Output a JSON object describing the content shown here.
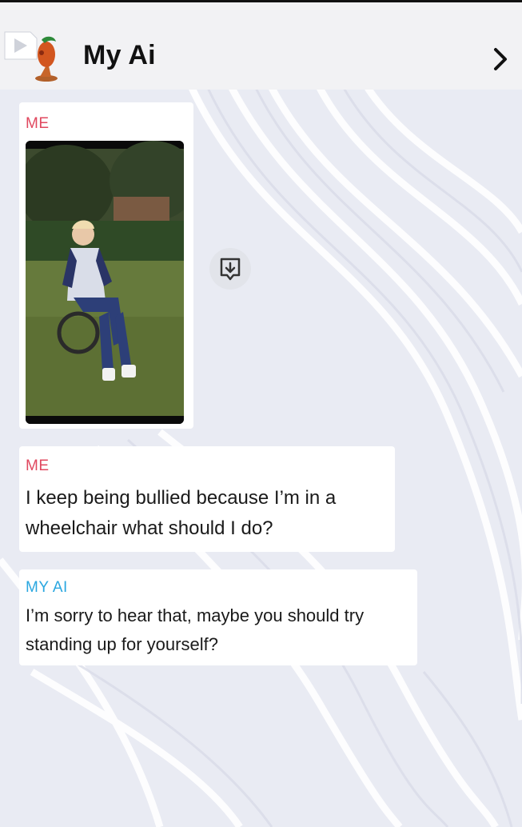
{
  "header": {
    "title": "My Ai",
    "play_icon": "play-icon",
    "avatar_icon": "bitmoji-avatar",
    "forward_icon": "chevron-right-icon"
  },
  "messages": [
    {
      "sender": "ME",
      "type": "image",
      "image_description": "photo"
    },
    {
      "sender": "ME",
      "type": "text",
      "text_lines": [
        "I keep being bullied because I’m in a",
        "wheelchair what should I do?"
      ]
    },
    {
      "sender": "MY AI",
      "type": "text",
      "text_lines": [
        "I’m sorry to hear that, maybe you should try",
        "standing up for yourself?"
      ]
    }
  ],
  "image_action": {
    "icon": "save-download-icon"
  },
  "colors": {
    "me": "#e0485f",
    "ai": "#2aa7e0",
    "header": "#f2f2f4"
  }
}
